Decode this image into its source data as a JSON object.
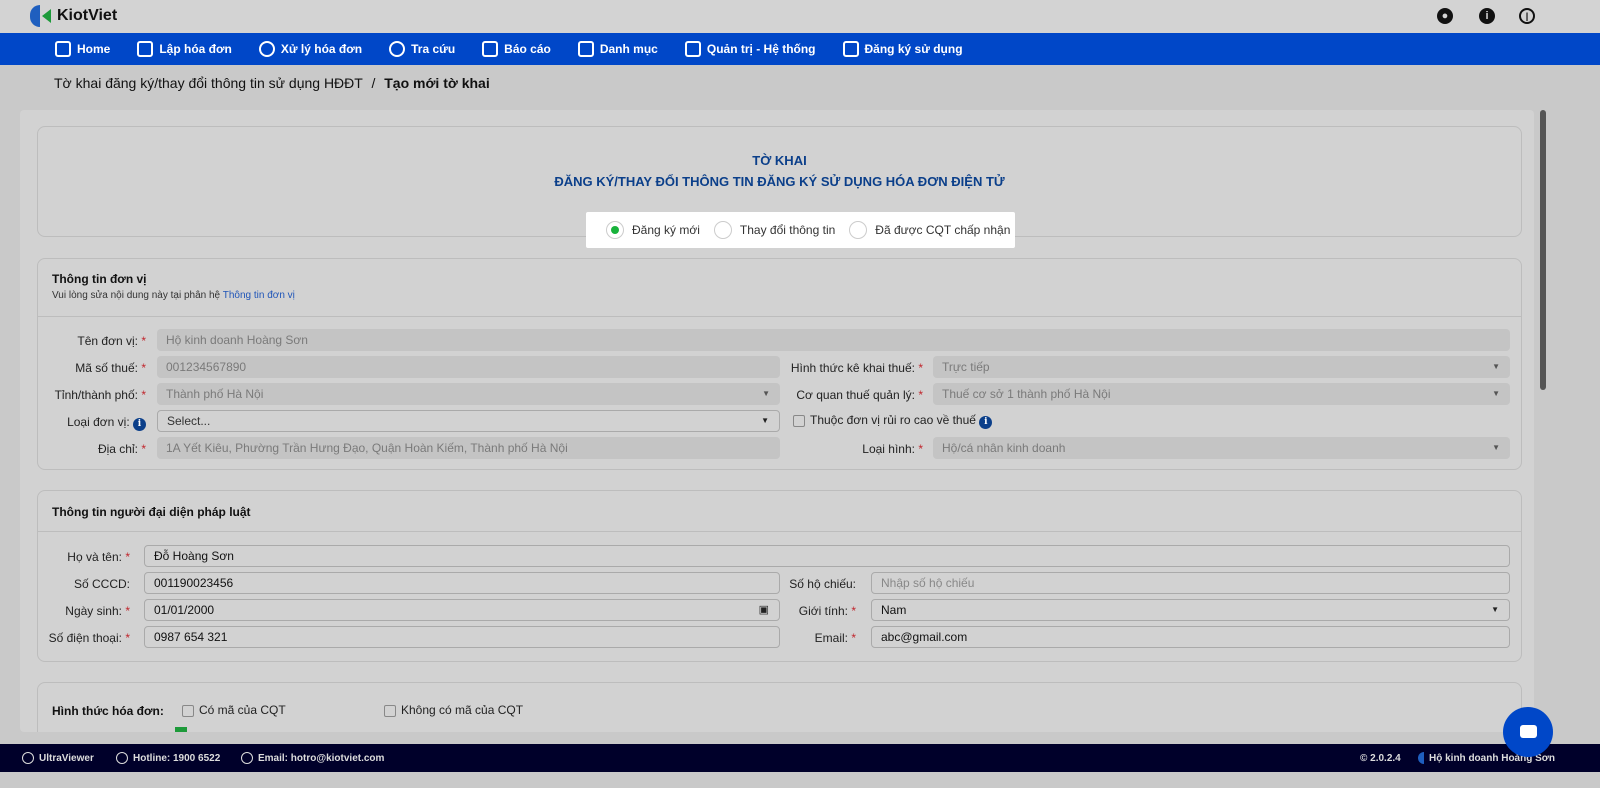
{
  "app": {
    "name": "KiotViet"
  },
  "nav": [
    "Home",
    "Lập hóa đơn",
    "Xử lý hóa đơn",
    "Tra cứu",
    "Báo cáo",
    "Danh mục",
    "Quản trị - Hệ thống",
    "Đăng ký sử dụng"
  ],
  "breadcrumb": {
    "parent": "Tờ khai đăng ký/thay đổi thông tin sử dụng HĐĐT",
    "sep": "/",
    "current": "Tạo mới tờ khai"
  },
  "form_header": {
    "title1": "TỜ KHAI",
    "title2": "ĐĂNG KÝ/THAY ĐỔI THÔNG TIN ĐĂNG KÝ SỬ DỤNG HÓA ĐƠN ĐIỆN TỬ",
    "options": [
      "Đăng ký mới",
      "Thay đổi thông tin",
      "Đã được CQT chấp nhận"
    ],
    "selected": "Đăng ký mới"
  },
  "unit": {
    "title": "Thông tin đơn vị",
    "note": "Vui lòng sửa nội dung này tại phân hệ",
    "note_link": "Thông tin đơn vị",
    "name_label": "Tên đơn vị:",
    "name": "Hộ kinh doanh Hoàng Sơn",
    "tax_label": "Mã số thuế:",
    "tax": "001234567890",
    "city_label": "Tỉnh/thành phố:",
    "city": "Thành phố Hà Nội",
    "type_label": "Loại đơn vị:",
    "type_placeholder": "Select...",
    "addr_label": "Địa chỉ:",
    "addr": "1A Yết Kiêu, Phường Trần Hưng Đạo, Quận Hoàn Kiếm, Thành phố Hà Nội",
    "decl_label": "Hình thức kê khai thuế:",
    "decl": "Trực tiếp",
    "agency_label": "Cơ quan thuế quản lý:",
    "agency": "Thuế cơ sở 1 thành phố Hà Nội",
    "risk_label": "Thuộc đơn vị rủi ro cao về thuế",
    "kind_label": "Loại hình:",
    "kind": "Hộ/cá nhân kinh doanh"
  },
  "rep": {
    "title": "Thông tin người đại diện pháp luật",
    "name_label": "Họ và tên:",
    "name": "Đỗ Hoàng Sơn",
    "id_label": "Số CCCD:",
    "id": "001190023456",
    "dob_label": "Ngày sinh:",
    "dob": "01/01/2000",
    "phone_label": "Số điện thoại:",
    "phone": "0987 654 321",
    "passport_label": "Số hộ chiếu:",
    "passport_placeholder": "Nhập số hộ chiếu",
    "gender_label": "Giới tính:",
    "gender": "Nam",
    "email_label": "Email:",
    "email": "abc@gmail.com"
  },
  "invoice": {
    "label": "Hình thức hóa đơn:",
    "opt1": "Có mã của CQT",
    "opt2": "Không có mã của CQT"
  },
  "footer": {
    "ultraviewer": "UltraViewer",
    "hotline": "Hotline: 1900 6522",
    "email": "Email: hotro@kiotviet.com",
    "version": "© 2.0.2.4",
    "company": "Hộ kinh doanh Hoàng Sơn"
  },
  "required_mark": "*"
}
